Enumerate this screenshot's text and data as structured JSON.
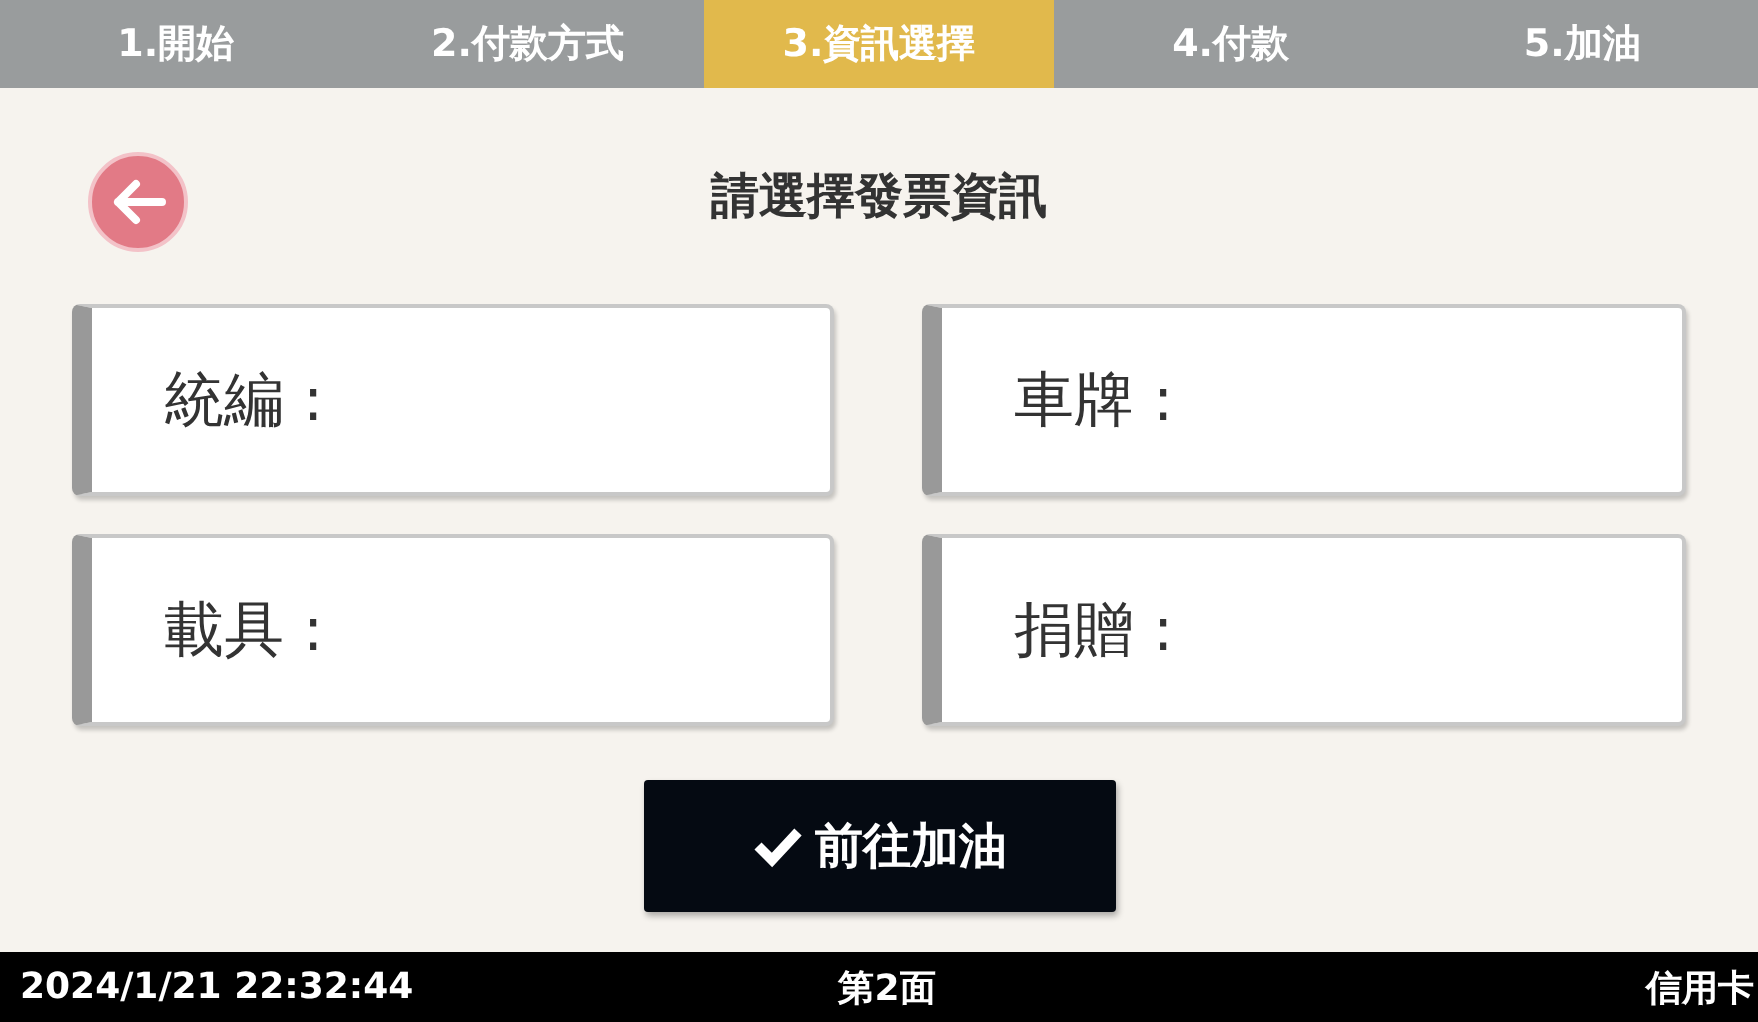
{
  "steps": [
    {
      "label": "1.開始",
      "selected": false
    },
    {
      "label": "2.付款方式",
      "selected": false
    },
    {
      "label": "3.資訊選擇",
      "selected": true
    },
    {
      "label": "4.付款",
      "selected": false
    },
    {
      "label": "5.加油",
      "selected": false
    }
  ],
  "title": "請選擇發票資訊",
  "fields": [
    {
      "label": "統編 :"
    },
    {
      "label": "車牌 :"
    },
    {
      "label": "載具 :"
    },
    {
      "label": "捐贈 :"
    }
  ],
  "confirm_button": "前往加油",
  "status_bar": {
    "datetime": "2024/1/21 22:32:44",
    "page": "第2面",
    "payment": "信用卡"
  }
}
